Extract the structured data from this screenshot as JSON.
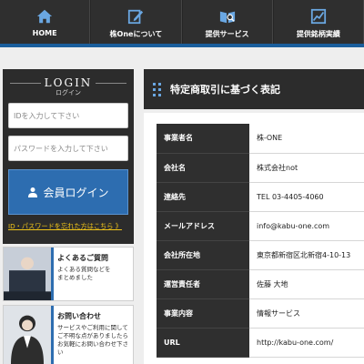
{
  "nav": {
    "items": [
      {
        "label": "HOME",
        "icon": "home-icon"
      },
      {
        "label": "株Oneについて",
        "icon": "edit-icon"
      },
      {
        "label": "提供サービス",
        "icon": "book-search-icon"
      },
      {
        "label": "提供銘柄実績",
        "icon": "chart-icon"
      }
    ],
    "accent": "#1a5e9c"
  },
  "login": {
    "title": "LOGIN",
    "subtitle": "ログイン",
    "id_placeholder": "IDを入力して下さい",
    "password_placeholder": "パスワードを入力して下さい",
    "button_label": "会員ログイン",
    "forgot_link": "ID・パスワードを忘れた方はこちら 》"
  },
  "cards": [
    {
      "title": "よくあるご質問",
      "text": "よくある質問などを\nまとめました"
    },
    {
      "title": "お問い合わせ",
      "text": "サービスやご利用に関して\nご不明な点がありましたら\nお気軽にお問い合わせ下さい"
    }
  ],
  "main": {
    "heading": "特定商取引に基づく表記",
    "rows": [
      {
        "key": "事業者名",
        "value": "株-ONE"
      },
      {
        "key": "会社名",
        "value": "株式会社not"
      },
      {
        "key": "連絡先",
        "value": "TEL 03-4405-4060"
      },
      {
        "key": "メールアドレス",
        "value": "info@kabu-one.com"
      },
      {
        "key": "会社所在地",
        "value": "東京都新宿区北新宿4-10-13"
      },
      {
        "key": "運営責任者",
        "value": "佐藤 大地"
      },
      {
        "key": "事業内容",
        "value": "情報サービス"
      },
      {
        "key": "URL",
        "value": "http://kabu-one.com/"
      }
    ]
  },
  "colors": {
    "dark": "#2c2c2c",
    "blue": "#2d6db0",
    "link_yellow": "#f0c419"
  }
}
